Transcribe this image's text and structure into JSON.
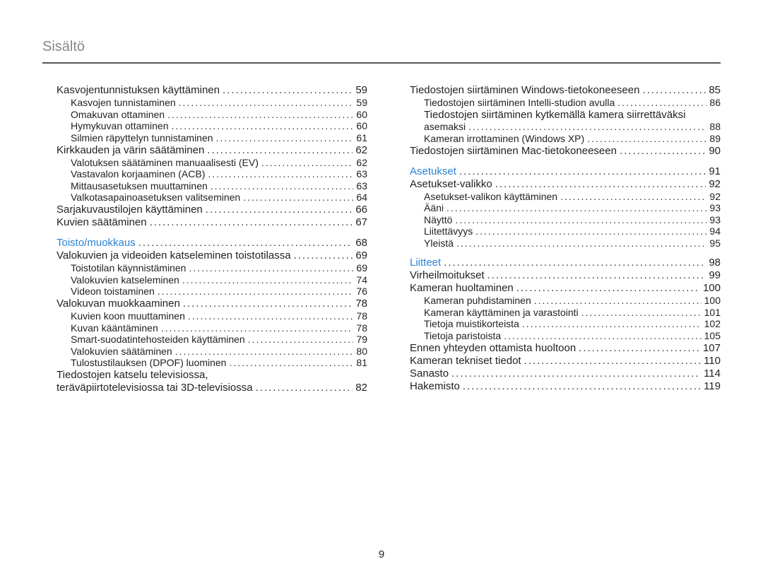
{
  "header": "Sisältö",
  "page_number": "9",
  "columns": [
    {
      "entries": [
        {
          "level": 1,
          "title": "Kasvojentunnistuksen käyttäminen",
          "page": "59"
        },
        {
          "level": 2,
          "title": "Kasvojen tunnistaminen",
          "page": "59"
        },
        {
          "level": 2,
          "title": "Omakuvan ottaminen",
          "page": "60"
        },
        {
          "level": 2,
          "title": "Hymykuvan ottaminen",
          "page": "60"
        },
        {
          "level": 2,
          "title": "Silmien räpyttelyn tunnistaminen",
          "page": "61"
        },
        {
          "level": 1,
          "title": "Kirkkauden ja värin säätäminen",
          "page": "62"
        },
        {
          "level": 2,
          "title": "Valotuksen säätäminen manuaalisesti (EV)",
          "page": "62"
        },
        {
          "level": 2,
          "title": "Vastavalon korjaaminen (ACB)",
          "page": "63"
        },
        {
          "level": 2,
          "title": "Mittausasetuksen muuttaminen",
          "page": "63"
        },
        {
          "level": 2,
          "title": "Valkotasapainoasetuksen valitseminen",
          "page": "64"
        },
        {
          "level": 1,
          "title": "Sarjakuvaustilojen käyttäminen",
          "page": "66"
        },
        {
          "level": 1,
          "title": "Kuvien säätäminen",
          "page": "67"
        },
        {
          "spacer": true
        },
        {
          "level": 1,
          "section": true,
          "title": "Toisto/muokkaus",
          "page": "68"
        },
        {
          "level": 1,
          "title": "Valokuvien ja videoiden katseleminen toistotilassa",
          "page": "69"
        },
        {
          "level": 2,
          "title": "Toistotilan käynnistäminen",
          "page": "69"
        },
        {
          "level": 2,
          "title": "Valokuvien katseleminen",
          "page": "74"
        },
        {
          "level": 2,
          "title": "Videon toistaminen",
          "page": "76"
        },
        {
          "level": 1,
          "title": "Valokuvan muokkaaminen",
          "page": "78"
        },
        {
          "level": 2,
          "title": "Kuvien koon muuttaminen",
          "page": "78"
        },
        {
          "level": 2,
          "title": "Kuvan kääntäminen",
          "page": "78"
        },
        {
          "level": 2,
          "title": "Smart-suodatintehosteiden käyttäminen",
          "page": "79"
        },
        {
          "level": 2,
          "title": "Valokuvien säätäminen",
          "page": "80"
        },
        {
          "level": 2,
          "title": "Tulostustilauksen (DPOF) luominen",
          "page": "81"
        },
        {
          "level": 1,
          "title_pre": "Tiedostojen katselu televisiossa,",
          "title": "teräväpiirtotelevisiossa tai 3D-televisiossa",
          "page": "82"
        }
      ]
    },
    {
      "entries": [
        {
          "level": 1,
          "title": "Tiedostojen siirtäminen Windows-tietokoneeseen",
          "page": "85"
        },
        {
          "level": 2,
          "title": "Tiedostojen siirtäminen Intelli-studion avulla",
          "page": "86"
        },
        {
          "level": 2,
          "title_pre": "Tiedostojen siirtäminen kytkemällä kamera siirrettäväksi",
          "title": "asemaksi",
          "page": "88"
        },
        {
          "level": 2,
          "title": "Kameran irrottaminen (Windows XP)",
          "page": "89"
        },
        {
          "level": 1,
          "title": "Tiedostojen siirtäminen Mac-tietokoneeseen",
          "page": "90"
        },
        {
          "spacer": true
        },
        {
          "level": 1,
          "section": true,
          "title": "Asetukset",
          "page": "91"
        },
        {
          "level": 1,
          "title": "Asetukset-valikko",
          "page": "92"
        },
        {
          "level": 2,
          "title": "Asetukset-valikon käyttäminen",
          "page": "92"
        },
        {
          "level": 2,
          "title": "Ääni",
          "page": "93"
        },
        {
          "level": 2,
          "title": "Näyttö",
          "page": "93"
        },
        {
          "level": 2,
          "title": "Liitettävyys",
          "page": "94"
        },
        {
          "level": 2,
          "title": "Yleistä",
          "page": "95"
        },
        {
          "spacer": true
        },
        {
          "level": 1,
          "section": true,
          "title": "Liitteet",
          "page": "98"
        },
        {
          "level": 1,
          "title": "Virheilmoitukset",
          "page": "99"
        },
        {
          "level": 1,
          "title": "Kameran huoltaminen",
          "page": "100"
        },
        {
          "level": 2,
          "title": "Kameran puhdistaminen",
          "page": "100"
        },
        {
          "level": 2,
          "title": "Kameran käyttäminen ja varastointi",
          "page": "101"
        },
        {
          "level": 2,
          "title": "Tietoja muistikorteista",
          "page": "102"
        },
        {
          "level": 2,
          "title": "Tietoja paristoista",
          "page": "105"
        },
        {
          "level": 1,
          "title": "Ennen yhteyden ottamista huoltoon",
          "page": "107"
        },
        {
          "level": 1,
          "title": "Kameran tekniset tiedot",
          "page": "110"
        },
        {
          "level": 1,
          "title": "Sanasto",
          "page": "114"
        },
        {
          "level": 1,
          "title": "Hakemisto",
          "page": "119"
        }
      ]
    }
  ]
}
